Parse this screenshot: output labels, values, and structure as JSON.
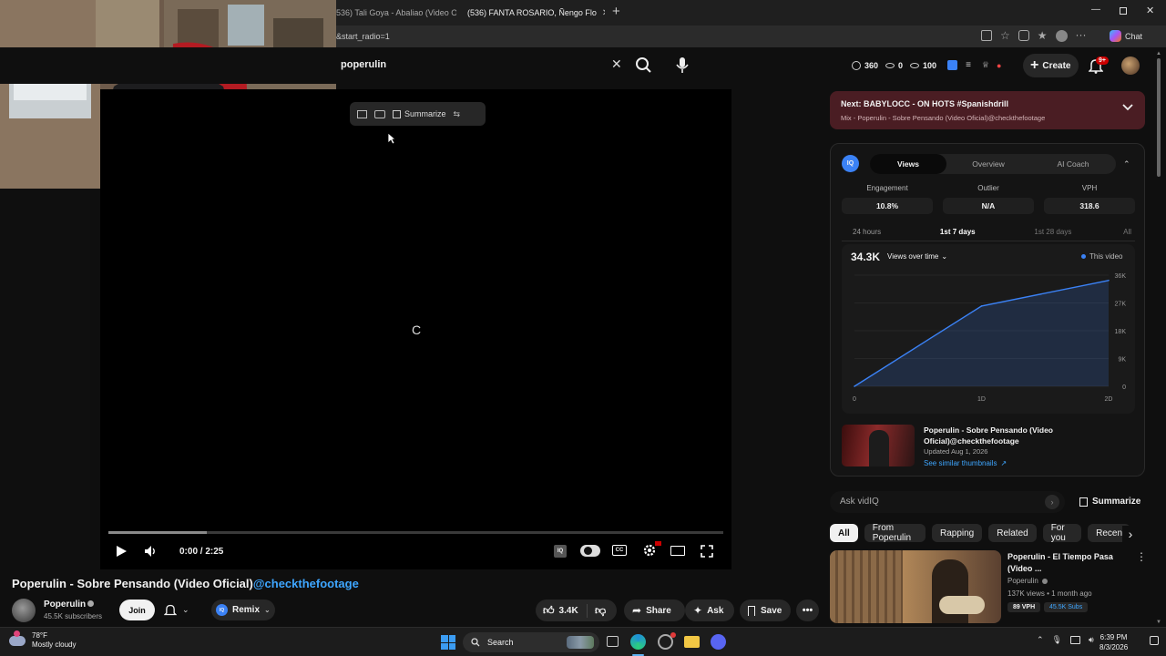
{
  "browser": {
    "tabs": [
      {
        "label": "536) Tali Goya - Abaliao (Video O"
      },
      {
        "label": "(536) FANTA ROSARIO, Ñengo Flo"
      }
    ],
    "address": "&start_radio=1",
    "chat_label": "Chat"
  },
  "header": {
    "search_value": "poperulin",
    "stats": [
      "360",
      "0",
      "100"
    ],
    "create_label": "Create",
    "notif_badge": "9+"
  },
  "player": {
    "tools": {
      "summarize": "Summarize"
    },
    "time": "0:00 / 2:25",
    "loading_glyph": "C",
    "progress_played": 0.0,
    "progress_buffered": 0.16
  },
  "video": {
    "title": "Poperulin - Sobre Pensando (Video Oficial)",
    "title_link": "@checkthefootage",
    "channel": "Poperulin",
    "subscribers": "45.5K subscribers",
    "join": "Join",
    "remix": "Remix",
    "likes": "3.4K",
    "share": "Share",
    "ask": "Ask",
    "save": "Save"
  },
  "next_up": {
    "title": "Next: BABYLOCC - ON HOTS #Spanishdrill",
    "subtitle": "Mix - Poperulin - Sobre Pensando (Video Oficial)@checkthefootage"
  },
  "vidiq": {
    "logo": "IQ",
    "tabs": [
      "Views",
      "Overview",
      "AI Coach"
    ],
    "metrics": [
      {
        "label": "Engagement",
        "value": "10.8%"
      },
      {
        "label": "Outlier",
        "value": "N/A"
      },
      {
        "label": "VPH",
        "value": "318.6"
      }
    ],
    "ranges": [
      "24 hours",
      "1st 7 days",
      "1st 28 days",
      "All"
    ],
    "total": "34.3K",
    "dropdown": "Views over time",
    "legend": "This video",
    "thumb_title": "Poperulin - Sobre Pensando (Video Oficial)@checkthefootage",
    "thumb_updated": "Updated Aug 1, 2026",
    "thumb_link": "See similar thumbnails",
    "ask_placeholder": "Ask vidIQ",
    "summarize": "Summarize"
  },
  "chart_data": {
    "type": "line",
    "x_ticks": [
      "0",
      "1D",
      "2D"
    ],
    "y_ticks": [
      "0",
      "9K",
      "18K",
      "27K",
      "36K"
    ],
    "ylim": [
      0,
      36000
    ],
    "series": [
      {
        "name": "This video",
        "x": [
          0,
          1,
          2
        ],
        "values": [
          0,
          26000,
          34300
        ]
      }
    ],
    "legend_position": "top-right",
    "colors": {
      "line": "#3b82f6"
    }
  },
  "chips": [
    "All",
    "From Poperulin",
    "Rapping",
    "Related",
    "For you",
    "Recen"
  ],
  "recommendation": {
    "title": "Poperulin - El Tiempo Pasa (Video ...",
    "channel": "Poperulin",
    "meta": "137K views • 1 month ago",
    "vph": "89 VPH",
    "subs": "45.5K Subs"
  },
  "taskbar": {
    "temp": "78°F",
    "weather": "Mostly cloudy",
    "search": "Search",
    "time": "6:39 PM",
    "date": "8/3/2026"
  },
  "colors": {
    "accent": "#3ea6ff",
    "next_bg": "#4a1d23",
    "vidiq": "#3b82f6",
    "red": "#cc0000"
  }
}
